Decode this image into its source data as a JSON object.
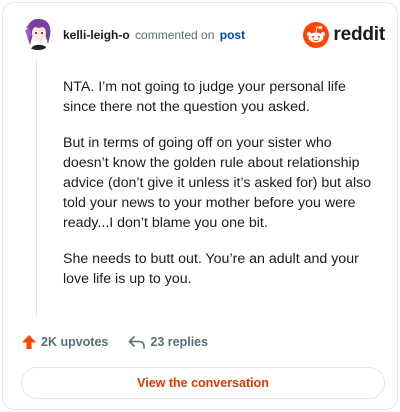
{
  "comment": {
    "username": "kelli-leigh-o",
    "action_text": "commented on",
    "post_link": "post",
    "paragraphs": [
      "NTA. I’m not going to judge your personal life since there not the question you asked.",
      "But in terms of going off on your sister who doesn’t know the golden rule about relationship advice (don’t give it unless it’s asked for) but also told your news to your mother before you were ready...I don’t blame you one bit.",
      "She needs to butt out. You’re an adult and your love life is up to you."
    ],
    "upvotes": "2K upvotes",
    "replies": "23 replies"
  },
  "brand": {
    "name": "reddit"
  },
  "cta": {
    "label": "View the conversation"
  },
  "colors": {
    "upvote_arrow": "#ff4500",
    "cta_text": "#d93a00",
    "link": "#0045ac",
    "brand_icon": "#ff4500"
  },
  "icons": [
    "avatar",
    "reddit-logo-icon",
    "upvote-arrow-icon",
    "reply-arrow-icon"
  ]
}
